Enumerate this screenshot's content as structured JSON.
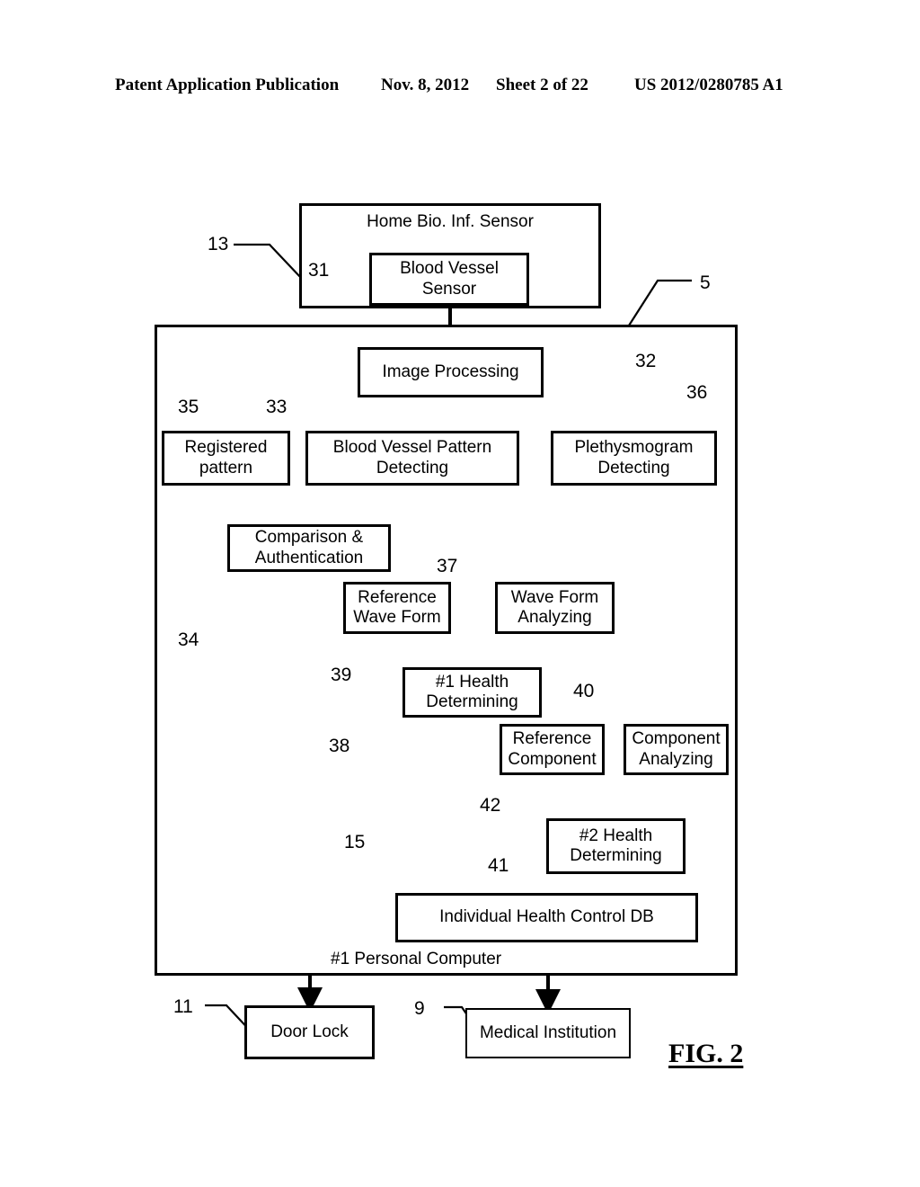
{
  "header": {
    "publication": "Patent Application Publication",
    "date": "Nov. 8, 2012",
    "sheet": "Sheet 2 of 22",
    "patent_number": "US 2012/0280785 A1"
  },
  "figure": {
    "caption": "FIG. 2",
    "boxes": {
      "home_sensor": "Home Bio. Inf. Sensor",
      "blood_vessel_sensor": "Blood Vessel\nSensor",
      "image_processing": "Image Processing",
      "registered_pattern": "Registered\npattern",
      "blood_vessel_pattern_detecting": "Blood Vessel Pattern\nDetecting",
      "plethysmogram_detecting": "Plethysmogram\nDetecting",
      "comparison_authentication": "Comparison &\nAuthentication",
      "reference_wave_form": "Reference\nWave Form",
      "wave_form_analyzing": "Wave Form\nAnalyzing",
      "health_determining_1": "#1 Health\nDetermining",
      "reference_component": "Reference\nComponent",
      "component_analyzing": "Component\nAnalyzing",
      "health_determining_2": "#2 Health\nDetermining",
      "individual_health_control_db": "Individual Health Control DB",
      "personal_computer": "#1 Personal Computer",
      "door_lock": "Door Lock",
      "medical_institution": "Medical Institution"
    },
    "reference_numerals": {
      "n13": "13",
      "n31": "31",
      "n5": "5",
      "n32": "32",
      "n35": "35",
      "n33": "33",
      "n36": "36",
      "n37": "37",
      "n34": "34",
      "n39": "39",
      "n38": "38",
      "n40": "40",
      "n42": "42",
      "n41": "41",
      "n15": "15",
      "n11": "11",
      "n9": "9"
    }
  }
}
